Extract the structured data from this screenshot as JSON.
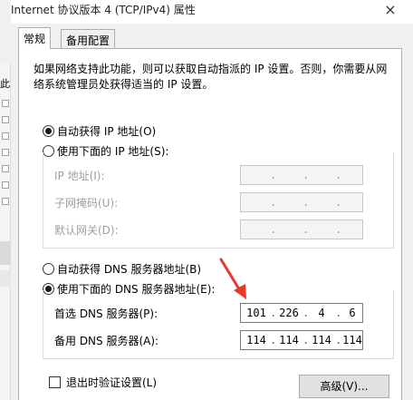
{
  "window": {
    "title": "Internet 协议版本 4 (TCP/IPv4) 属性",
    "close_glyph": "×"
  },
  "background": {
    "edge_label": "此"
  },
  "tabs": [
    {
      "label": "常规",
      "active": true
    },
    {
      "label": "备用配置",
      "active": false
    }
  ],
  "general": {
    "intro": "如果网络支持此功能，则可以获取自动指派的 IP 设置。否则，你需要从网络系统管理员处获得适当的 IP 设置。",
    "ip_auto_label": "自动获得 IP 地址(O)",
    "ip_manual_label": "使用下面的 IP 地址(S):",
    "ip_mode": "auto",
    "ip_fields": [
      {
        "label": "IP 地址(I):",
        "segments": [
          "",
          "",
          "",
          ""
        ]
      },
      {
        "label": "子网掩码(U):",
        "segments": [
          "",
          "",
          "",
          ""
        ]
      },
      {
        "label": "默认网关(D):",
        "segments": [
          "",
          "",
          "",
          ""
        ]
      }
    ],
    "dns_auto_label": "自动获得 DNS 服务器地址(B)",
    "dns_manual_label": "使用下面的 DNS 服务器地址(E):",
    "dns_mode": "manual",
    "dns_fields": [
      {
        "label": "首选 DNS 服务器(P):",
        "segments": [
          "101",
          "226",
          "4",
          "6"
        ]
      },
      {
        "label": "备用 DNS 服务器(A):",
        "segments": [
          "114",
          "114",
          "114",
          "114"
        ]
      }
    ],
    "validate_label": "退出时验证设置(L)",
    "validate_checked": false,
    "advanced_label": "高级(V)..."
  },
  "colors": {
    "annotation_arrow": "#e8392e"
  }
}
